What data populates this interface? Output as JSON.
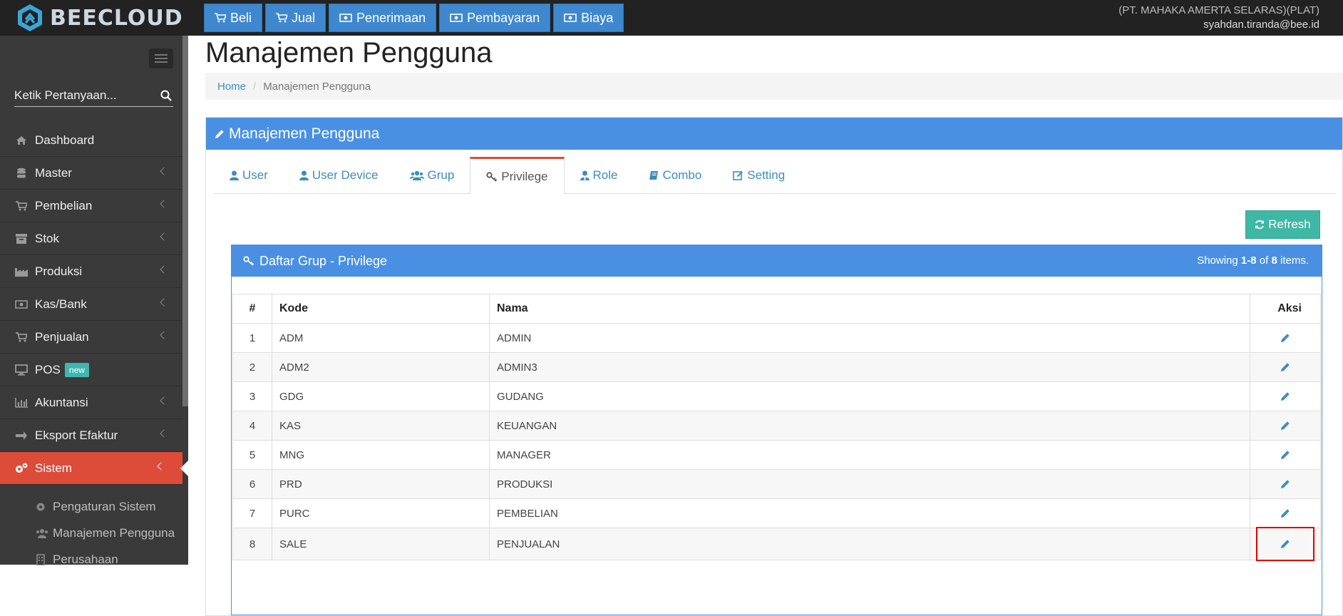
{
  "brand": {
    "name": "BEECLOUD"
  },
  "topnav": [
    {
      "label": "Beli",
      "icon": "cart-icon"
    },
    {
      "label": "Jual",
      "icon": "cart-icon"
    },
    {
      "label": "Penerimaan",
      "icon": "money-icon"
    },
    {
      "label": "Pembayaran",
      "icon": "money-icon"
    },
    {
      "label": "Biaya",
      "icon": "money-icon"
    }
  ],
  "account": {
    "company": "(PT. MAHAKA AMERTA SELARAS)(PLAT)",
    "email": "syahdan.tiranda@bee.id"
  },
  "sidebar": {
    "search_placeholder": "Ketik Pertanyaan...",
    "items": [
      {
        "label": "Dashboard"
      },
      {
        "label": "Master"
      },
      {
        "label": "Pembelian"
      },
      {
        "label": "Stok"
      },
      {
        "label": "Produksi"
      },
      {
        "label": "Kas/Bank"
      },
      {
        "label": "Penjualan"
      },
      {
        "label": "POS",
        "badge": "new"
      },
      {
        "label": "Akuntansi"
      },
      {
        "label": "Eksport Efaktur"
      },
      {
        "label": "Sistem"
      }
    ],
    "submenu": [
      {
        "label": "Pengaturan Sistem"
      },
      {
        "label": "Manajemen Pengguna"
      },
      {
        "label": "Perusahaan"
      }
    ]
  },
  "page": {
    "title": "Manajemen Pengguna",
    "breadcrumb": {
      "home": "Home",
      "current": "Manajemen Pengguna"
    }
  },
  "panel": {
    "title": "Manajemen Pengguna",
    "tabs": [
      {
        "label": "User"
      },
      {
        "label": "User Device"
      },
      {
        "label": "Grup"
      },
      {
        "label": "Privilege"
      },
      {
        "label": "Role"
      },
      {
        "label": "Combo"
      },
      {
        "label": "Setting"
      }
    ],
    "refresh_label": "Refresh"
  },
  "grid": {
    "title": "Daftar Grup - Privilege",
    "summary": {
      "prefix": "Showing ",
      "range": "1-8",
      "of": " of ",
      "total": "8",
      "suffix": " items."
    },
    "columns": {
      "no": "#",
      "kode": "Kode",
      "nama": "Nama",
      "aksi": "Aksi"
    },
    "rows": [
      {
        "no": "1",
        "kode": "ADM",
        "nama": "ADMIN"
      },
      {
        "no": "2",
        "kode": "ADM2",
        "nama": "ADMIN3"
      },
      {
        "no": "3",
        "kode": "GDG",
        "nama": "GUDANG"
      },
      {
        "no": "4",
        "kode": "KAS",
        "nama": "KEUANGAN"
      },
      {
        "no": "5",
        "kode": "MNG",
        "nama": "MANAGER"
      },
      {
        "no": "6",
        "kode": "PRD",
        "nama": "PRODUKSI"
      },
      {
        "no": "7",
        "kode": "PURC",
        "nama": "PEMBELIAN"
      },
      {
        "no": "8",
        "kode": "SALE",
        "nama": "PENJUALAN"
      }
    ]
  },
  "colors": {
    "primary": "#4a90e2",
    "active_menu": "#dd4b39",
    "refresh": "#3fb7a5",
    "highlight": "#dd0000"
  }
}
